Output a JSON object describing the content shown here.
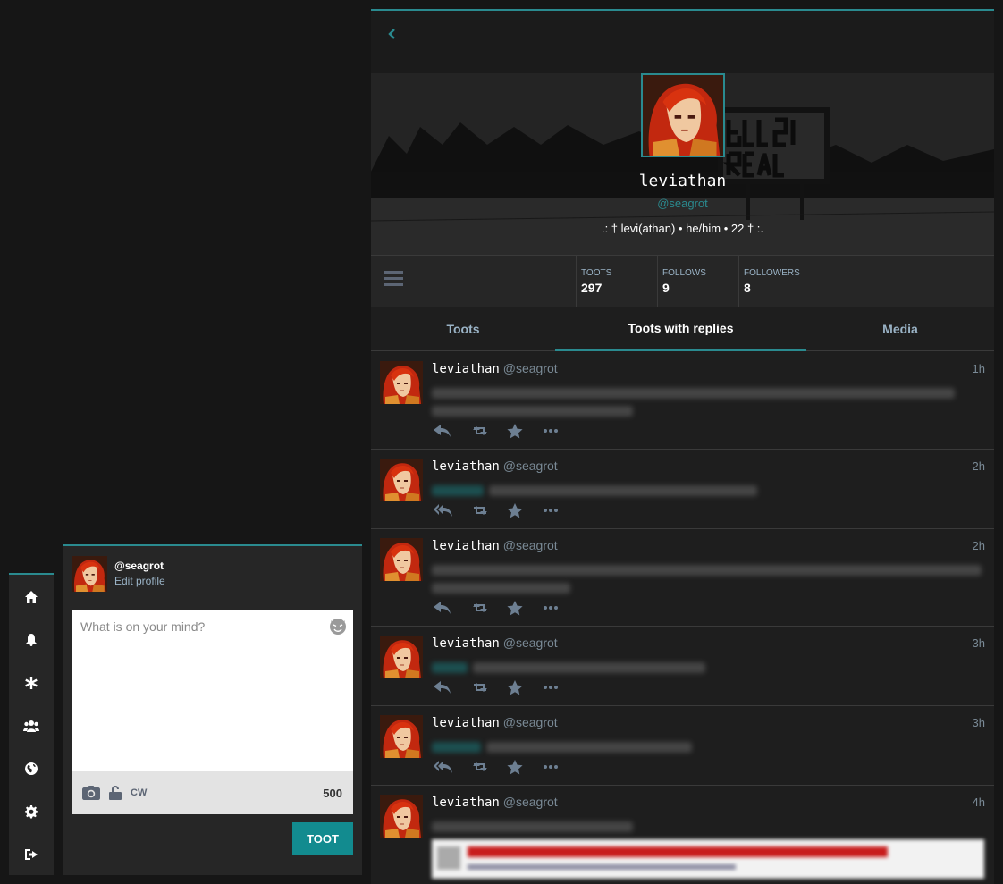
{
  "nav": {
    "items": [
      {
        "icon": "home-icon",
        "name": "nav-home"
      },
      {
        "icon": "bell-icon",
        "name": "nav-notifications"
      },
      {
        "icon": "asterisk-icon",
        "name": "nav-local"
      },
      {
        "icon": "users-icon",
        "name": "nav-federated-users"
      },
      {
        "icon": "globe-icon",
        "name": "nav-federated"
      },
      {
        "icon": "gear-icon",
        "name": "nav-preferences"
      },
      {
        "icon": "sign-out-icon",
        "name": "nav-logout"
      }
    ]
  },
  "compose": {
    "handle": "@seagrot",
    "edit_profile": "Edit profile",
    "placeholder": "What is on your mind?",
    "cw_label": "CW",
    "char_count": "500",
    "submit_label": "TOOT"
  },
  "profile": {
    "display_name": "leviathan",
    "handle": "@seagrot",
    "bio": ".: † levi(athan) • he/him • 22 † :.",
    "stats": [
      {
        "label": "TOOTS",
        "value": "297"
      },
      {
        "label": "FOLLOWS",
        "value": "9"
      },
      {
        "label": "FOLLOWERS",
        "value": "8"
      }
    ],
    "tabs": [
      "Toots",
      "Toots with replies",
      "Media"
    ],
    "active_tab": "Toots with replies"
  },
  "statuses": [
    {
      "display_name": "leviathan",
      "acct": "@seagrot",
      "time": "1h"
    },
    {
      "display_name": "leviathan",
      "acct": "@seagrot",
      "time": "2h"
    },
    {
      "display_name": "leviathan",
      "acct": "@seagrot",
      "time": "2h"
    },
    {
      "display_name": "leviathan",
      "acct": "@seagrot",
      "time": "3h"
    },
    {
      "display_name": "leviathan",
      "acct": "@seagrot",
      "time": "3h"
    },
    {
      "display_name": "leviathan",
      "acct": "@seagrot",
      "time": "4h"
    }
  ],
  "colors": {
    "accent": "#2a8a8f",
    "toot_button": "#128b8f",
    "background": "#161616",
    "panel": "#262626"
  }
}
